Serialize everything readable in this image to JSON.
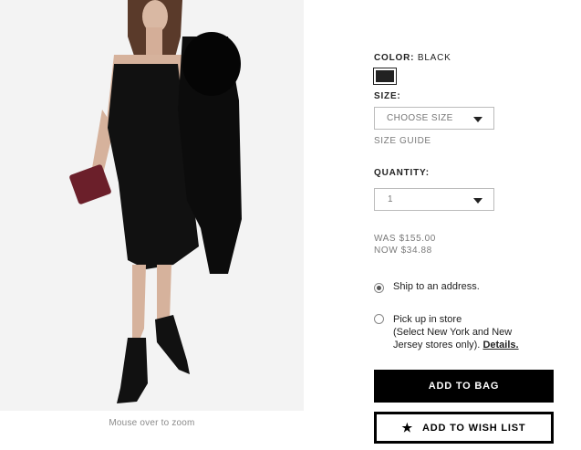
{
  "product_image": {
    "zoom_hint": "Mouse over to zoom"
  },
  "color": {
    "label": "COLOR:",
    "value": "BLACK",
    "swatch_color": "#222222"
  },
  "size": {
    "label": "SIZE:",
    "selected": "CHOOSE SIZE",
    "guide_link": "SIZE GUIDE"
  },
  "quantity": {
    "label": "QUANTITY:",
    "selected": "1"
  },
  "price": {
    "was": "WAS $155.00",
    "now": "NOW $34.88"
  },
  "delivery": {
    "ship_label": "Ship to an address.",
    "ship_selected": true,
    "pickup_line1": "Pick up in store",
    "pickup_line2": "(Select New York and New",
    "pickup_line3": "Jersey stores only).",
    "pickup_details": "Details.",
    "pickup_selected": false
  },
  "buttons": {
    "add_to_bag": "ADD TO BAG",
    "add_to_wish_list": "ADD TO WISH LIST"
  }
}
